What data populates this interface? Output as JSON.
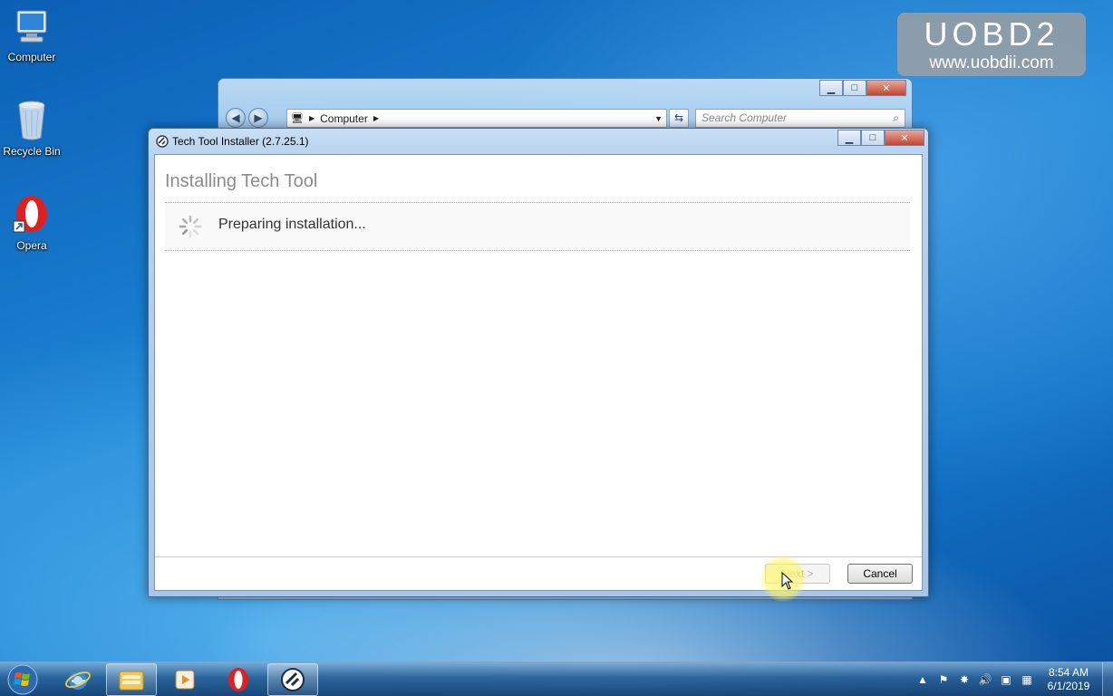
{
  "desktop": {
    "icons": [
      {
        "label": "Computer"
      },
      {
        "label": "Recycle Bin"
      },
      {
        "label": "Opera"
      }
    ]
  },
  "watermark": {
    "brand": "UOBD2",
    "url": "www.uobdii.com"
  },
  "explorer": {
    "address_item": "Computer",
    "search_placeholder": "Search Computer"
  },
  "installer": {
    "title": "Tech Tool Installer (2.7.25.1)",
    "heading": "Installing Tech Tool",
    "status": "Preparing installation...",
    "next_label": "Next >",
    "cancel_label": "Cancel"
  },
  "taskbar": {
    "items": [
      "start-orb",
      "internet-explorer",
      "windows-explorer",
      "media-player",
      "opera",
      "tech-tool"
    ],
    "time": "8:54 AM",
    "date": "6/1/2019"
  },
  "colors": {
    "accent": "#1d86d6",
    "close": "#c5452f"
  }
}
